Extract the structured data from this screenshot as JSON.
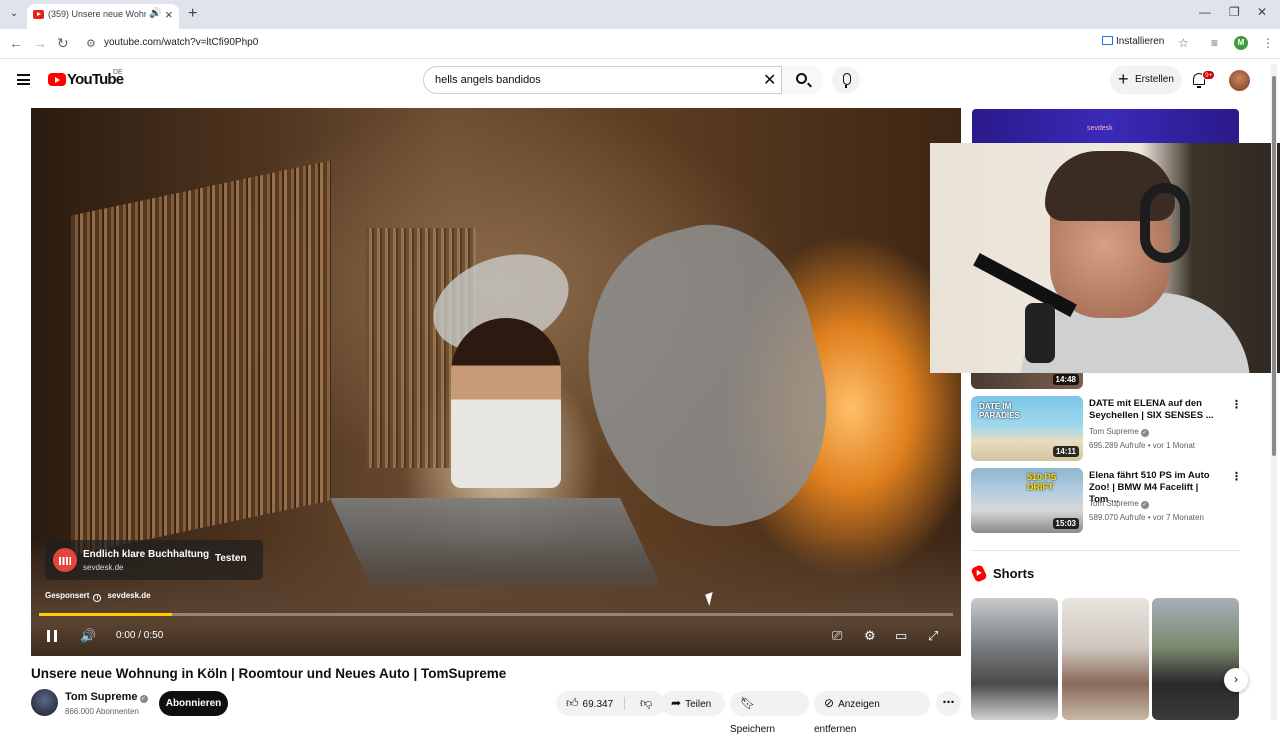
{
  "browser": {
    "tab_title": "(359) Unsere neue Wohnung",
    "url": "youtube.com/watch?v=ltCfi90Php0",
    "install_label": "Installieren",
    "profile_initial": "M"
  },
  "header": {
    "logo_text": "YouTube",
    "country_code": "DE",
    "search_query": "hells angels bandidos",
    "create_label": "Erstellen",
    "notification_count": "9+"
  },
  "player": {
    "ad": {
      "headline": "Endlich klare Buchhaltung",
      "domain": "sevdesk.de",
      "cta": "Testen",
      "sponsored_label": "Gesponsert",
      "sponsor_domain": "sevdesk.de"
    },
    "time_display": "0:00 / 0:50",
    "progress": 0.145
  },
  "video": {
    "title": "Unsere neue Wohnung in Köln | Roomtour und Neues Auto | TomSupreme",
    "channel_name": "Tom Supreme",
    "subscribers": "866.000 Abonnenten",
    "subscribe_label": "Abonnieren",
    "like_count": "69.347",
    "share_label": "Teilen",
    "save_label": "Speichern",
    "remove_ads_label": "Anzeigen entfernen"
  },
  "sidebar": {
    "ad_brand": "sevdesk",
    "partial_video_duration": "14:48",
    "videos": [
      {
        "title": "DATE mit ELENA auf den Seychellen | SIX SENSES ...",
        "channel": "Tom Supreme",
        "views": "695.289 Aufrufe",
        "age": "vor 1 Monat",
        "duration": "14:11",
        "thumb_text": "DATE IM PARADIES"
      },
      {
        "title": "Elena fährt 510 PS im Auto Zoo! | BMW M4 Facelift | Tom ...",
        "channel": "Tom Supreme",
        "views": "589.070 Aufrufe",
        "age": "vor 7 Monaten",
        "duration": "15:03",
        "thumb_text": "510 PS DRIFT"
      }
    ],
    "shorts_title": "Shorts"
  }
}
